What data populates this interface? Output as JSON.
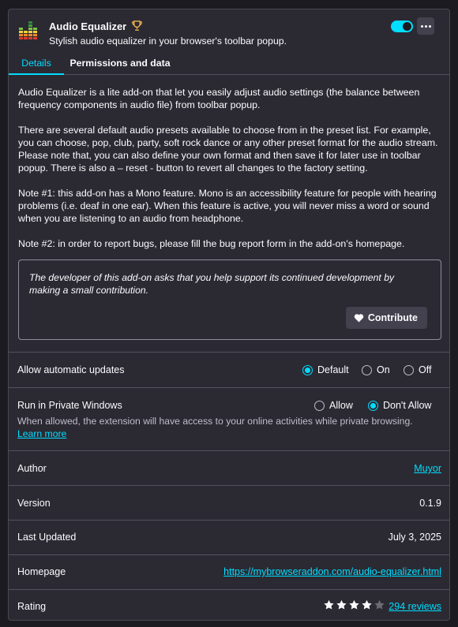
{
  "header": {
    "name": "Audio Equalizer",
    "description": "Stylish audio equalizer in your browser's toolbar popup.",
    "enabled": true,
    "icon": "equalizer-app-icon",
    "badge_icon": "trophy-icon",
    "more_icon": "more-options-icon"
  },
  "tabs": [
    {
      "label": "Details",
      "active": true
    },
    {
      "label": "Permissions and data",
      "active": false
    }
  ],
  "description": {
    "paragraphs": [
      "Audio Equalizer is a lite add-on that let you easily adjust audio settings (the balance between frequency components in audio file) from toolbar popup.",
      "There are several default audio presets available to choose from in the preset list. For example, you can choose, pop, club, party, soft rock dance or any other preset format for the audio stream. Please note that, you can also define your own format and then save it for later use in toolbar popup. There is also a – reset - button to revert all changes to the factory setting.",
      "Note #1: this add-on has a Mono feature. Mono is an accessibility feature for people with hearing problems (i.e. deaf in one ear). When this feature is active, you will never miss a word or sound when you are listening to an audio from headphone.",
      "Note #2: in order to report bugs, please fill the bug report form in the add-on's homepage."
    ]
  },
  "contribution": {
    "text": "The developer of this add-on asks that you help support its continued development by making a small contribution.",
    "button_label": "Contribute"
  },
  "updates": {
    "label": "Allow automatic updates",
    "options": [
      "Default",
      "On",
      "Off"
    ],
    "selected": "Default"
  },
  "private": {
    "label": "Run in Private Windows",
    "options": [
      "Allow",
      "Don't Allow"
    ],
    "selected": "Don't Allow",
    "note": "When allowed, the extension will have access to your online activities while private browsing.",
    "learn_more": "Learn more"
  },
  "details": {
    "author_label": "Author",
    "author": "Muyor",
    "version_label": "Version",
    "version": "0.1.9",
    "updated_label": "Last Updated",
    "updated": "July 3, 2025",
    "homepage_label": "Homepage",
    "homepage": "https://mybrowseraddon.com/audio-equalizer.html",
    "rating_label": "Rating",
    "rating": 4,
    "rating_max": 5,
    "reviews": "294 reviews"
  },
  "colors": {
    "accent": "#00ddff",
    "card": "#2b2a33",
    "background": "#1c1b22"
  }
}
